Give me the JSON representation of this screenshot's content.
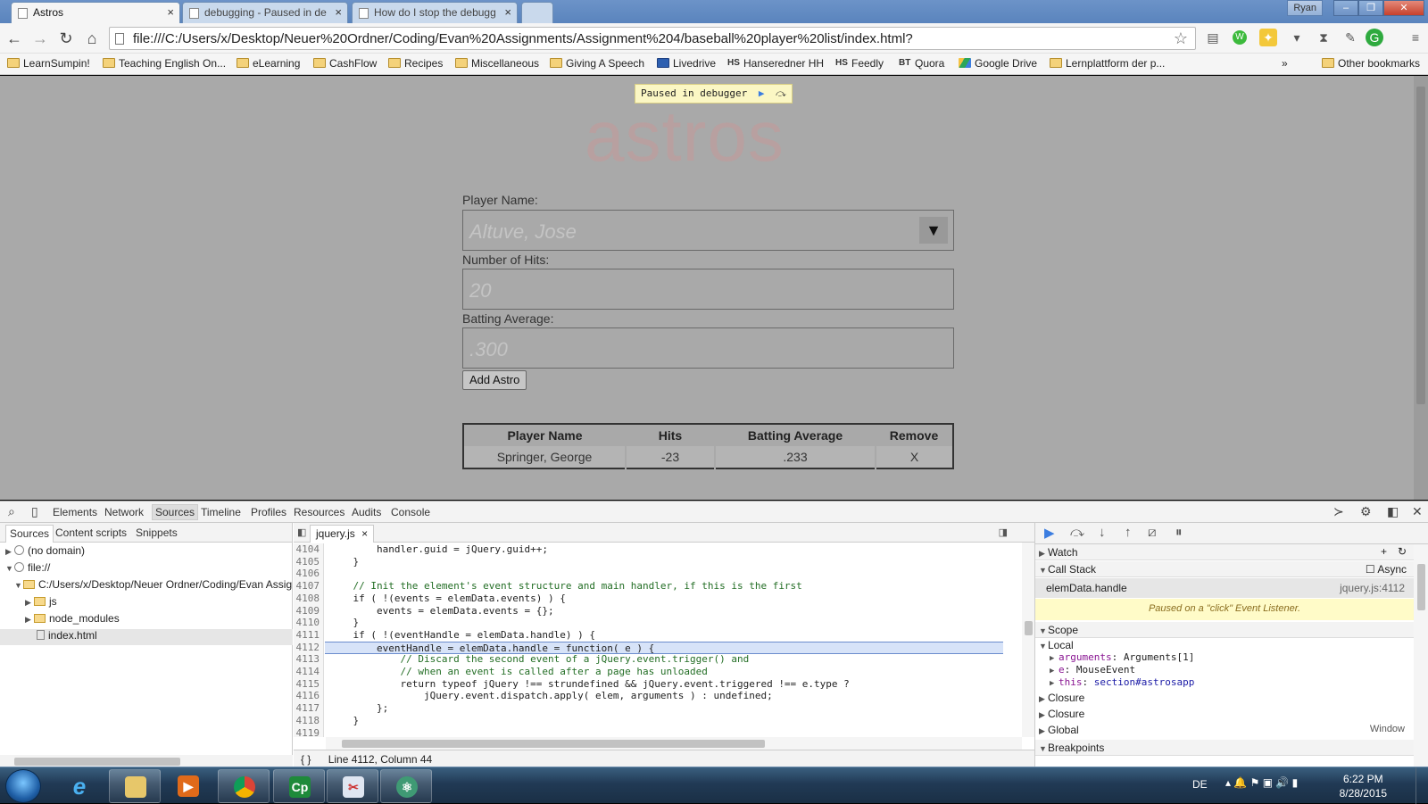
{
  "browser": {
    "tabs": [
      {
        "title": "Astros",
        "active": true
      },
      {
        "title": "debugging - Paused in de",
        "active": false
      },
      {
        "title": "How do I stop the debugg",
        "active": false
      }
    ],
    "user": "Ryan",
    "url": "file:///C:/Users/x/Desktop/Neuer%20Ordner/Coding/Evan%20Assignments/Assignment%204/baseball%20player%20list/index.html?",
    "bookmarks": [
      {
        "label": "LearnSumpin!",
        "icon": "folder-icon"
      },
      {
        "label": "Teaching English On...",
        "icon": "folder-icon"
      },
      {
        "label": "eLearning",
        "icon": "folder-icon"
      },
      {
        "label": "CashFlow",
        "icon": "folder-icon"
      },
      {
        "label": "Recipes",
        "icon": "folder-icon"
      },
      {
        "label": "Miscellaneous",
        "icon": "folder-icon"
      },
      {
        "label": "Giving A Speech",
        "icon": "folder-icon"
      },
      {
        "label": "Livedrive",
        "icon": "livedrive-icon"
      },
      {
        "label": "Hanseredner HH",
        "icon": "hs-icon"
      },
      {
        "label": "Feedly",
        "icon": "hs-icon"
      },
      {
        "label": "Quora",
        "icon": "bt-icon"
      },
      {
        "label": "Google Drive",
        "icon": "google-drive-icon"
      },
      {
        "label": "Lernplattform der p...",
        "icon": "lernplattform-icon"
      }
    ],
    "more_bookmarks": "»",
    "other_bookmarks": "Other bookmarks"
  },
  "page": {
    "paused_label": "Paused in debugger",
    "logo": "astros",
    "player_name_label": "Player Name:",
    "player_name_placeholder": "Altuve, Jose",
    "hits_label": "Number of Hits:",
    "hits_placeholder": "20",
    "avg_label": "Batting Average:",
    "avg_placeholder": ".300",
    "add_button": "Add Astro",
    "table": {
      "headers": [
        "Player Name",
        "Hits",
        "Batting Average",
        "Remove"
      ],
      "rows": [
        [
          "Springer, George",
          "-23",
          ".233",
          "X"
        ]
      ]
    }
  },
  "devtools": {
    "tabs": [
      "Elements",
      "Network",
      "Sources",
      "Timeline",
      "Profiles",
      "Resources",
      "Audits",
      "Console"
    ],
    "selected_tab": "Sources",
    "nav_tabs": [
      "Sources",
      "Content scripts",
      "Snippets"
    ],
    "tree": [
      {
        "label": "(no domain)"
      },
      {
        "label": "file://"
      },
      {
        "label": "C:/Users/x/Desktop/Neuer Ordner/Coding/Evan Assig"
      },
      {
        "label": "js"
      },
      {
        "label": "node_modules"
      },
      {
        "label": "index.html"
      }
    ],
    "open_file": "jquery.js",
    "code_lines": [
      {
        "n": "4104",
        "text": "        handler.guid = jQuery.guid++;"
      },
      {
        "n": "4105",
        "text": "    }"
      },
      {
        "n": "4106",
        "text": ""
      },
      {
        "n": "4107",
        "text": "    // Init the element's event structure and main handler, if this is the first"
      },
      {
        "n": "4108",
        "text": "    if ( !(events = elemData.events) ) {"
      },
      {
        "n": "4109",
        "text": "        events = elemData.events = {};"
      },
      {
        "n": "4110",
        "text": "    }"
      },
      {
        "n": "4111",
        "text": "    if ( !(eventHandle = elemData.handle) ) {"
      },
      {
        "n": "4112",
        "text": "        eventHandle = elemData.handle = function( e ) {"
      },
      {
        "n": "4113",
        "text": "            // Discard the second event of a jQuery.event.trigger() and"
      },
      {
        "n": "4114",
        "text": "            // when an event is called after a page has unloaded"
      },
      {
        "n": "4115",
        "text": "            return typeof jQuery !== strundefined && jQuery.event.triggered !== e.type ?"
      },
      {
        "n": "4116",
        "text": "                jQuery.event.dispatch.apply( elem, arguments ) : undefined;"
      },
      {
        "n": "4117",
        "text": "        };"
      },
      {
        "n": "4118",
        "text": "    }"
      },
      {
        "n": "4119",
        "text": ""
      }
    ],
    "status": "Line 4112, Column 44",
    "status_icon": "{ }",
    "sidebar": {
      "watch": "Watch",
      "call_stack": "Call Stack",
      "async": "Async",
      "frame": "elemData.handle",
      "frame_loc": "jquery.js:4112",
      "paused_msg": "Paused on a \"click\" Event Listener.",
      "scope": "Scope",
      "local": "Local",
      "locals": [
        {
          "name": "arguments",
          "value": "Arguments[1]"
        },
        {
          "name": "e",
          "value": "MouseEvent"
        },
        {
          "name": "this",
          "value": "section#astrosapp"
        }
      ],
      "closure1": "Closure",
      "closure2": "Closure",
      "global": "Global",
      "global_val": "Window",
      "breakpoints": "Breakpoints"
    }
  },
  "taskbar": {
    "lang": "DE",
    "time": "6:22 PM",
    "date": "8/28/2015",
    "apps": [
      "internet-explorer-icon",
      "file-explorer-icon",
      "media-player-icon",
      "chrome-icon",
      "camtasia-icon",
      "screenshot-tool-icon",
      "atom-icon"
    ]
  }
}
